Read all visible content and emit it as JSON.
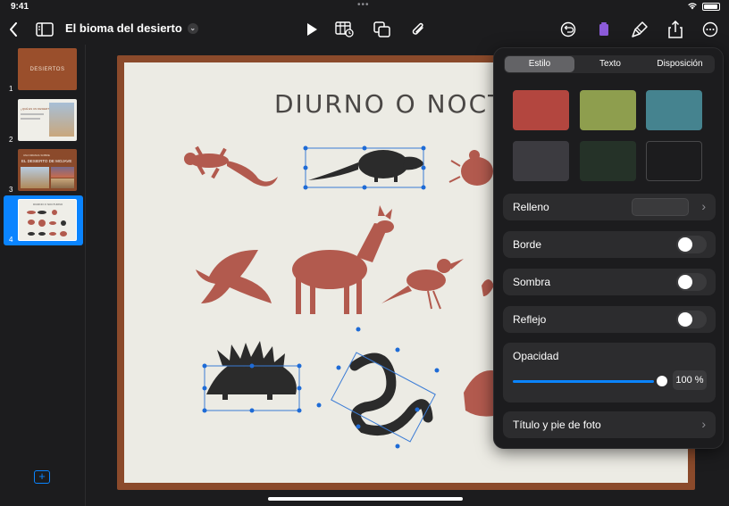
{
  "status": {
    "time": "9:41",
    "dots": "•••"
  },
  "toolbar": {
    "title": "El bioma del desierto",
    "icons": [
      "back-icon",
      "navigator-icon",
      "play-icon",
      "table-icon",
      "shapes-icon",
      "attachment-icon",
      "undo-icon",
      "delete-icon",
      "format-icon",
      "share-icon",
      "more-icon"
    ]
  },
  "navigator": {
    "slides": [
      {
        "num": "1",
        "title": "DESIERTOS"
      },
      {
        "num": "2",
        "title": "¿QUÉ ES UN DESIERTO?"
      },
      {
        "num": "3",
        "title": "EL DESIERTO DE MOJAVE",
        "subtitle": "UNA MIRADA SOBRE"
      },
      {
        "num": "4",
        "title": "DIURNO O NOCTURNO"
      }
    ],
    "selected": "4"
  },
  "slide": {
    "title": "DIURNO O NOCTURNO"
  },
  "format_panel": {
    "tabs": [
      "Estilo",
      "Texto",
      "Disposición"
    ],
    "active_tab": "Estilo",
    "swatch_colors": [
      "#b3463f",
      "#8e9e4e",
      "#45838f",
      "#3c3b40",
      "#253228",
      "#2a2a2c"
    ],
    "rows": {
      "fill": "Relleno",
      "border": "Borde",
      "shadow": "Sombra",
      "reflection": "Reflejo",
      "opacity": "Opacidad",
      "caption": "Título y pie de foto"
    },
    "toggles": {
      "border": false,
      "shadow": false,
      "reflection": false
    },
    "opacity_value": "100 %",
    "opacity_fraction": 1.0
  },
  "colors": {
    "accent": "#0a84ff",
    "animal_red": "#b25a4e",
    "animal_dark": "#2b2b2b"
  }
}
